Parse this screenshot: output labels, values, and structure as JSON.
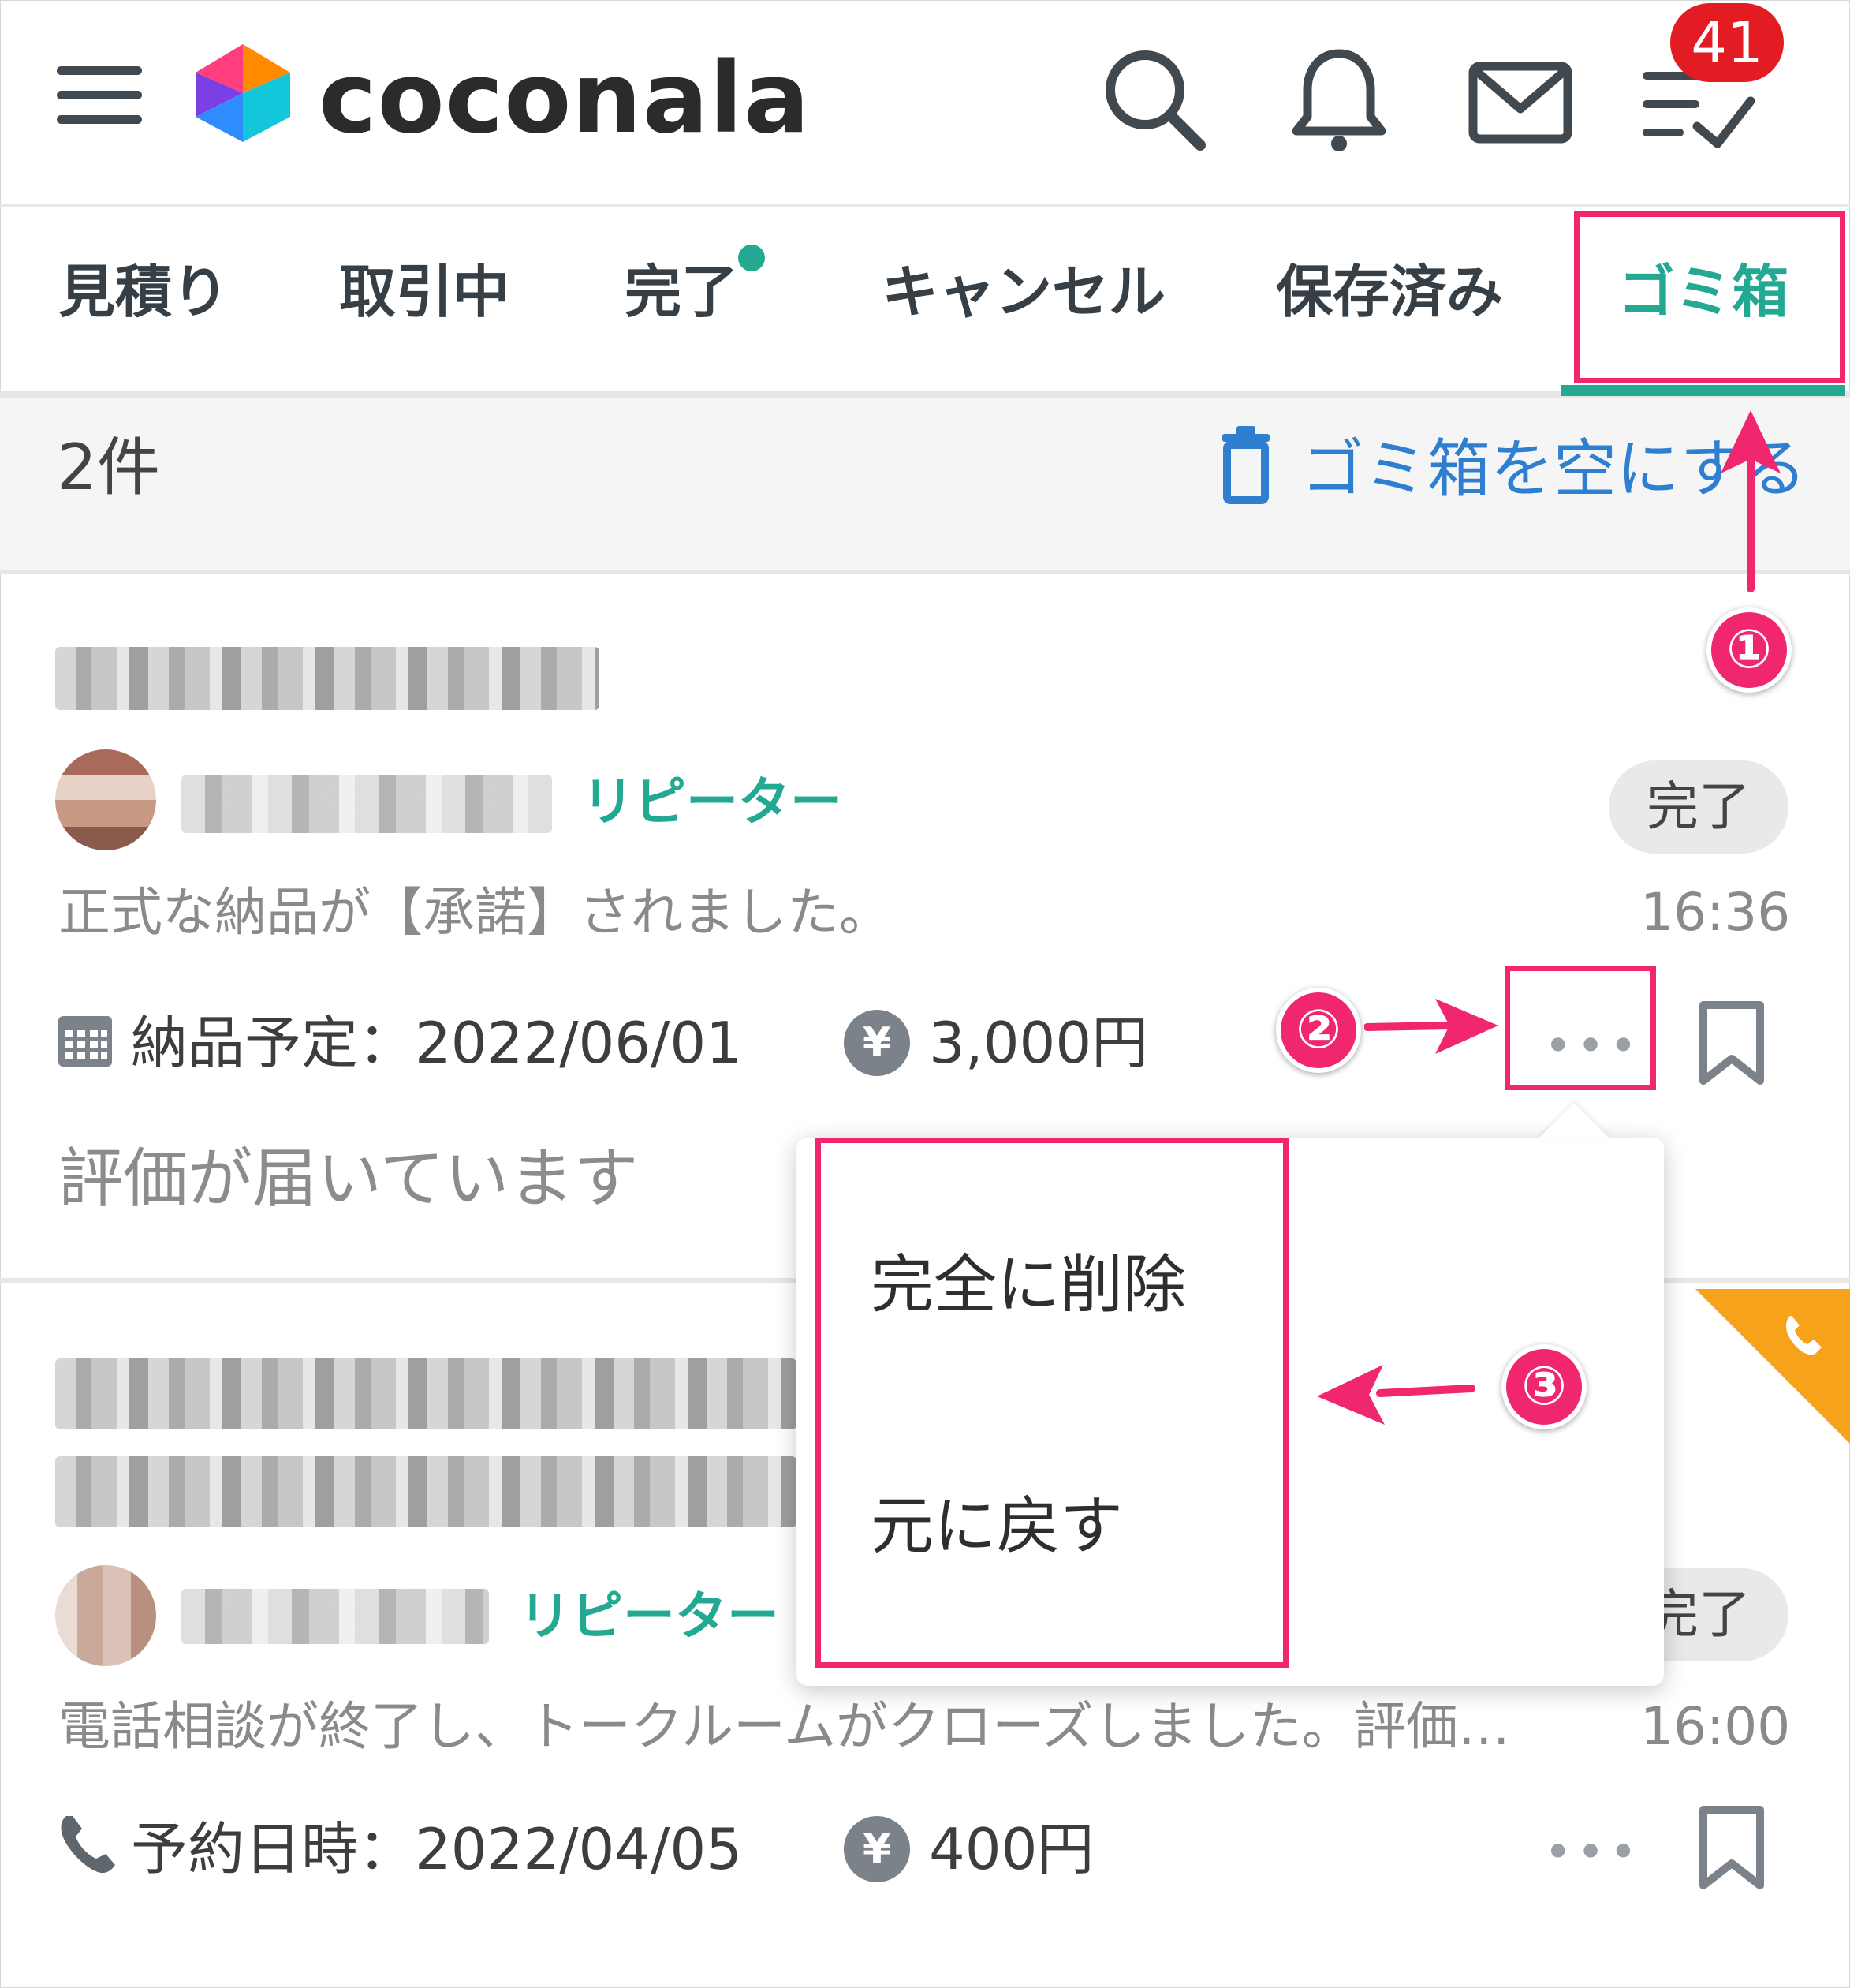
{
  "header": {
    "logo_text": "coconala",
    "badge_count": "41",
    "icons": [
      "menu-icon",
      "search-icon",
      "bell-icon",
      "mail-icon",
      "checklist-icon"
    ]
  },
  "tabs": [
    {
      "label": "見積り"
    },
    {
      "label": "取引中"
    },
    {
      "label": "完了"
    },
    {
      "label": "キャンセル"
    },
    {
      "label": "保存済み"
    },
    {
      "label": "ゴミ箱"
    }
  ],
  "summary": {
    "count": "2件",
    "empty_trash_label": "ゴミ箱を空にする"
  },
  "items": [
    {
      "badge": "リピーター",
      "status": "完了",
      "message": "正式な納品が【承諾】されました。",
      "time": "16:36",
      "date_label": "納品予定：2022/06/01",
      "price": "3,000円",
      "more": "•••",
      "review_note": "評価が届いています"
    },
    {
      "badge": "リピーター",
      "status": "完了",
      "message": "電話相談が終了し、トークルームがクローズしました。評価…",
      "time": "16:00",
      "date_label": "予約日時：2022/04/05",
      "price": "400円",
      "more": "•••"
    }
  ],
  "popup_menu": {
    "items": [
      "完全に削除",
      "元に戻す"
    ]
  },
  "annotations": {
    "step1": "①",
    "step2": "②",
    "step3": "③"
  },
  "yen_symbol": "¥",
  "colors": {
    "accent_green": "#23a892",
    "link_blue": "#2f7fd0",
    "annotation_pink": "#f0266f",
    "badge_red": "#e31b23",
    "phone_orange": "#f7a21b"
  }
}
